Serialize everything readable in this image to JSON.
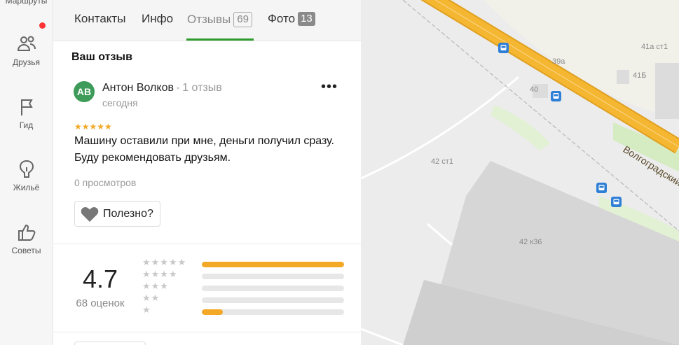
{
  "rail": {
    "items": [
      {
        "label": "Маршруты",
        "icon": "routes-icon"
      },
      {
        "label": "Друзья",
        "icon": "friends-icon"
      },
      {
        "label": "Гид",
        "icon": "flag-icon"
      },
      {
        "label": "Жильё",
        "icon": "housing-icon"
      },
      {
        "label": "Советы",
        "icon": "thumbs-up-icon"
      }
    ]
  },
  "tabs": [
    {
      "label": "Контакты",
      "count": ""
    },
    {
      "label": "Инфо",
      "count": ""
    },
    {
      "label": "Отзывы",
      "count": "69"
    },
    {
      "label": "Фото",
      "count": "13"
    }
  ],
  "review": {
    "section_title": "Ваш отзыв",
    "avatar_initials": "АВ",
    "author": "Антон Волков",
    "author_reviews": "1 отзыв",
    "date": "сегодня",
    "stars": "★★★★★",
    "text": "Машину оставили при мне, деньги получил сразу. Буду рекомендовать друзьям.",
    "views": "0 просмотров",
    "useful_label": "Полезно?"
  },
  "rating": {
    "value": "4.7",
    "count_label": "68 оценок",
    "distribution": [
      {
        "stars": "★★★★★",
        "share": 1.0
      },
      {
        "stars": "★★★★",
        "share": 0.0
      },
      {
        "stars": "★★★",
        "share": 0.0
      },
      {
        "stars": "★★",
        "share": 0.0
      },
      {
        "stars": "★",
        "share": 0.15
      }
    ]
  },
  "map": {
    "labels": [
      "39а",
      "41а ст1",
      "41Б",
      "40",
      "42 ст1",
      "42 к36"
    ],
    "road_name": "Волгоградский",
    "colors": {
      "road": "#f5b731",
      "green": "#d5ecc2",
      "building": "#d8d8d8",
      "bus": "#2f7fd6"
    }
  }
}
